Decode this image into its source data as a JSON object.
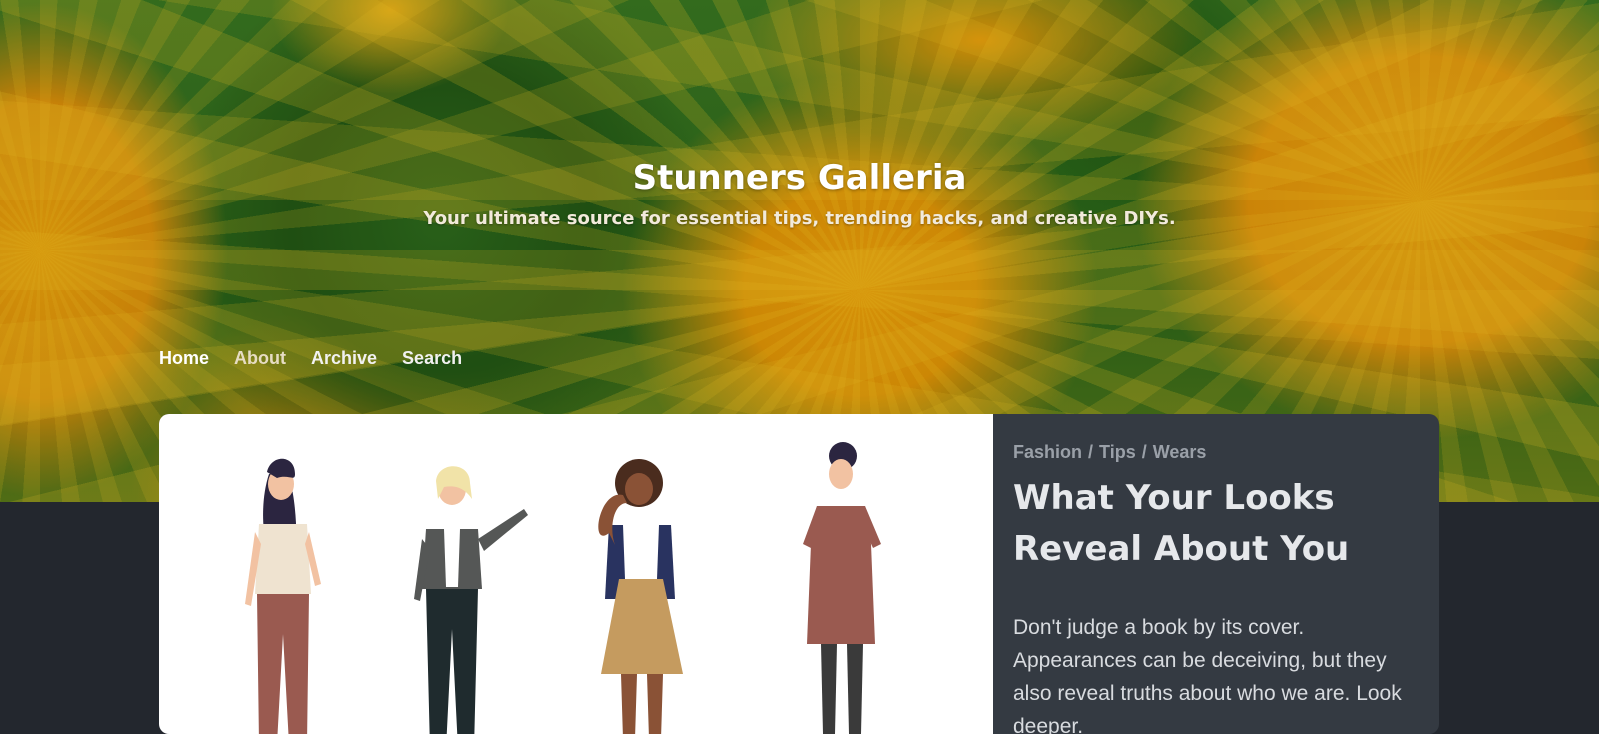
{
  "site": {
    "title": "Stunners Galleria",
    "tagline": "Your ultimate source for essential tips, trending hacks, and creative DIYs."
  },
  "nav": {
    "items": [
      {
        "label": "Home"
      },
      {
        "label": "About"
      },
      {
        "label": "Archive"
      },
      {
        "label": "Search"
      }
    ]
  },
  "post": {
    "categories": [
      "Fashion",
      "Tips",
      "Wears"
    ],
    "separator": "/",
    "title": "What Your Looks Reveal About You",
    "excerpt": "Don't judge a book by its cover. Appearances can be deceiving, but they also reveal truths about who we are. Look deeper."
  },
  "colors": {
    "page_background": "#23272e",
    "card_background": "#343a42",
    "title_text": "#ffffff",
    "breadcrumb_text": "#9aa0a8"
  }
}
